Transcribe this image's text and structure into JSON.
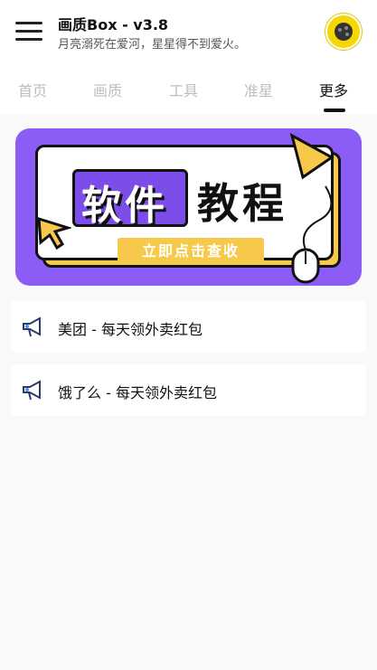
{
  "header": {
    "title": "画质Box - v3.8",
    "subtitle": "月亮溺死在爱河，星星得不到爱火。"
  },
  "tabs": [
    {
      "label": "首页",
      "active": false
    },
    {
      "label": "画质",
      "active": false
    },
    {
      "label": "工具",
      "active": false
    },
    {
      "label": "准星",
      "active": false
    },
    {
      "label": "更多",
      "active": true
    }
  ],
  "banner": {
    "word1": "软件",
    "word2": "教程",
    "cta": "立即点击查收"
  },
  "items": [
    {
      "label": "美团 - 每天领外卖红包"
    },
    {
      "label": "饿了么 - 每天领外卖红包"
    }
  ],
  "colors": {
    "banner_bg": "#8b5cf6",
    "accent_yellow": "#f7c94a"
  }
}
